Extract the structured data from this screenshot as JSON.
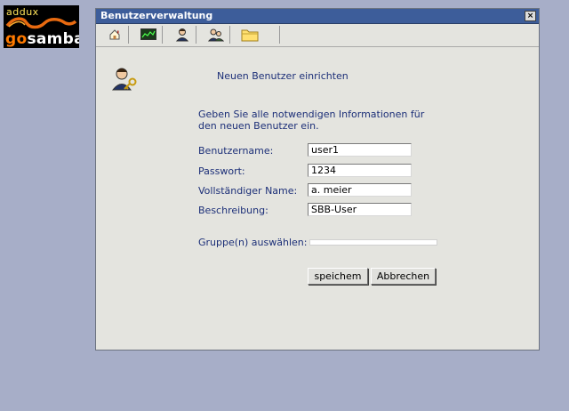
{
  "logo": {
    "line1": "addux",
    "line2_prefix": "go",
    "line2_suffix": "samba"
  },
  "window": {
    "title": "Benutzerverwaltung",
    "close_label": "×"
  },
  "toolbar": {
    "items": [
      {
        "icon": "home-icon"
      },
      {
        "icon": "monitor-icon"
      },
      {
        "icon": "user-icon"
      },
      {
        "icon": "users-icon"
      },
      {
        "icon": "folder-icon"
      }
    ]
  },
  "form": {
    "heading": "Neuen Benutzer einrichten",
    "intro": "Geben Sie alle notwendigen Informationen für den neuen Benutzer ein.",
    "fields": {
      "username": {
        "label": "Benutzername:",
        "value": "user1"
      },
      "password": {
        "label": "Passwort:",
        "value": "1234"
      },
      "fullname": {
        "label": "Vollständiger Name:",
        "value": "a. meier"
      },
      "description": {
        "label": "Beschreibung:",
        "value": "SBB-User"
      }
    },
    "group_label": "Gruppe(n) auswählen:",
    "save_label": "speichem",
    "cancel_label": "Abbrechen"
  }
}
